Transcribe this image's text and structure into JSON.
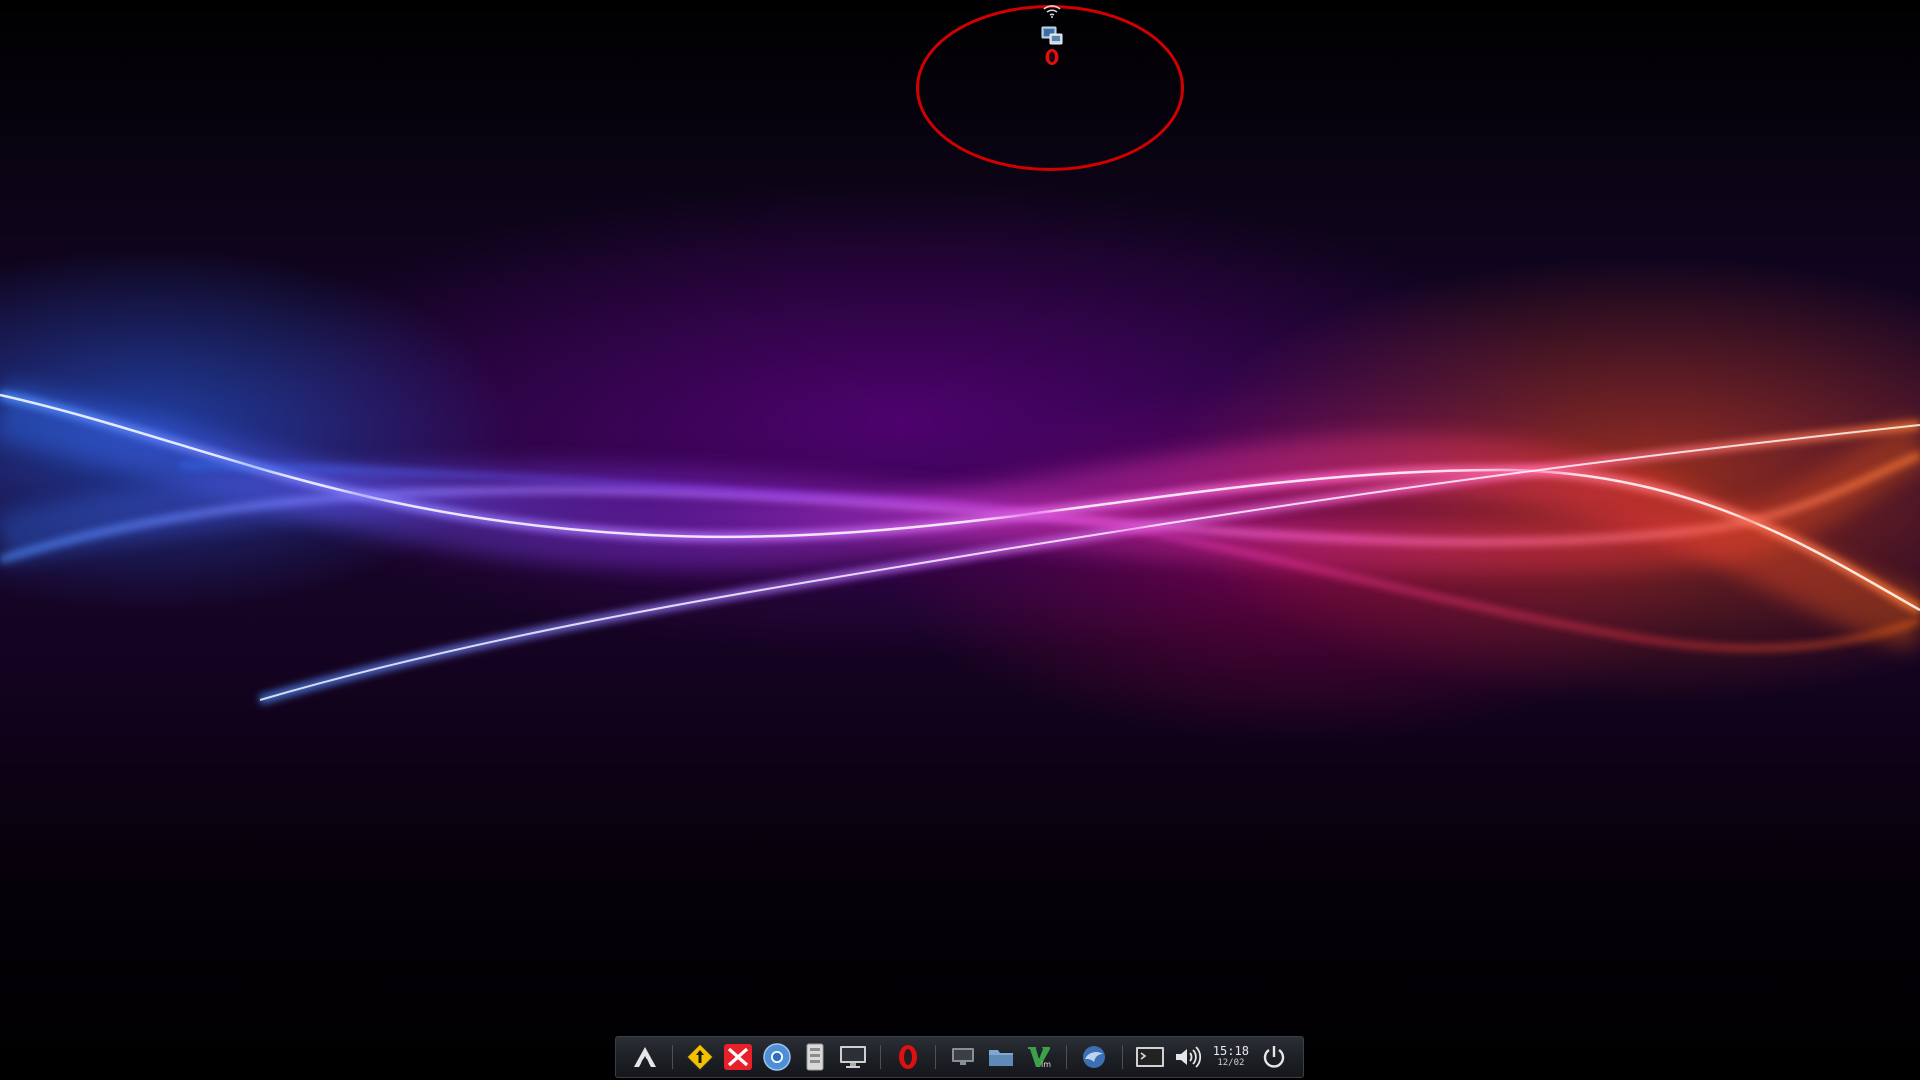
{
  "desktop": {
    "wallpaper": "abstract-light-waves",
    "colors": {
      "blue": "#3a7bff",
      "purple": "#a020f0",
      "pink": "#ff2fa0",
      "orange": "#ff5a10",
      "highlight": "#d40000"
    }
  },
  "top_tray": {
    "icons": [
      "wifi-icon",
      "network-manager-icon",
      "opera-icon"
    ]
  },
  "dock": {
    "items": [
      "arch-launcher-icon",
      "update-notifier-icon",
      "xmind-icon",
      "chromium-icon",
      "file-manager-icon",
      "display-settings-icon",
      "opera-icon",
      "show-desktop-icon",
      "folder-icon",
      "vim-icon",
      "thunderbird-icon",
      "terminal-icon",
      "volume-icon",
      "power-icon"
    ],
    "clock": {
      "time": "15:18",
      "date": "12/02"
    }
  }
}
